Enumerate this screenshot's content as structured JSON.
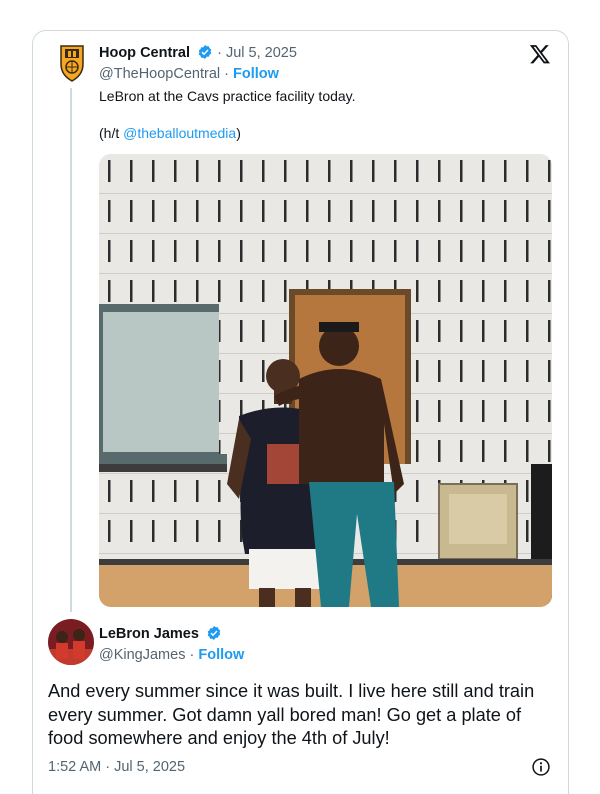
{
  "quoted_tweet": {
    "display_name": "Hoop Central",
    "date": "· Jul 5, 2025",
    "handle": "@TheHoopCentral",
    "separator": "·",
    "follow_label": "Follow",
    "text": "LeBron at the Cavs practice facility today.",
    "hat_tip_prefix": "(h/t ",
    "hat_tip_mention": "@theballoutmedia",
    "hat_tip_suffix": ")",
    "avatar_icon": "hoop-central-shield-logo",
    "verified_icon": "verified-badge-icon",
    "photo_alt": "Two men posing in a gym with white acoustic walls and a wooden door"
  },
  "reply_tweet": {
    "display_name": "LeBron James",
    "handle": "@KingJames",
    "separator": "·",
    "follow_label": "Follow",
    "text": "And every summer since it was built. I live here still and train every summer. Got damn yall bored man! Go get a plate of food somewhere and enjoy the 4th of July!",
    "timestamp": "1:52 AM · Jul 5, 2025",
    "avatar_icon": "profile-photo",
    "verified_icon": "verified-badge-icon"
  },
  "platform_icon": "x-logo-icon",
  "info_icon": "info-circle-icon",
  "colors": {
    "accent": "#1d9bf0",
    "text": "#0f1419",
    "muted": "#536471",
    "border": "#cfd9de"
  }
}
